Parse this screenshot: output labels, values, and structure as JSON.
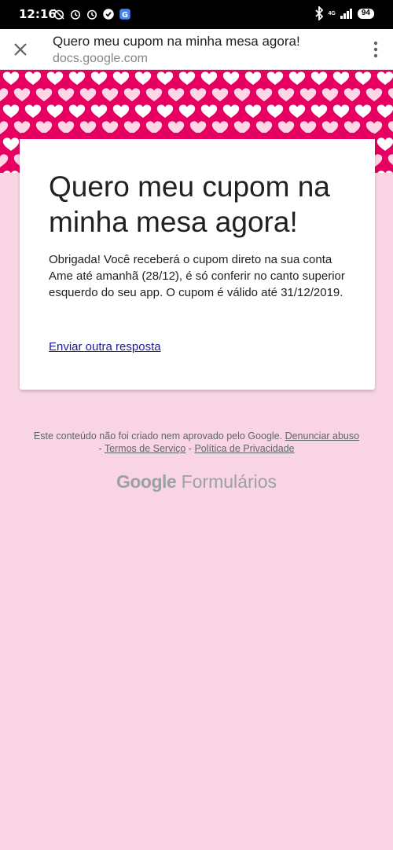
{
  "status_bar": {
    "time": "12:16",
    "network": "4G",
    "battery": "94"
  },
  "browser": {
    "page_title": "Quero meu cupom na minha mesa agora!",
    "url": "docs.google.com",
    "icons": [
      "close-icon",
      "more-vert-icon"
    ]
  },
  "form": {
    "accent_color": "#e60062",
    "background_color": "#f9d5e4",
    "title": "Quero meu cupom na minha mesa agora!",
    "confirmation_message": "Obrigada! Você receberá o cupom direto na sua conta Ame até amanhã (28/12), é só conferir no canto superior esquerdo do seu app. O cupom é válido até 31/12/2019.",
    "another_response_link": "Enviar outra resposta"
  },
  "footer": {
    "disclaimer": "Este conteúdo não foi criado nem aprovado pelo Google.",
    "report_abuse": "Denunciar abuso",
    "separator": " - ",
    "terms": "Termos de Serviço",
    "privacy": "Política de Privacidade",
    "brand_google": "Google",
    "brand_product": "Formulários"
  }
}
